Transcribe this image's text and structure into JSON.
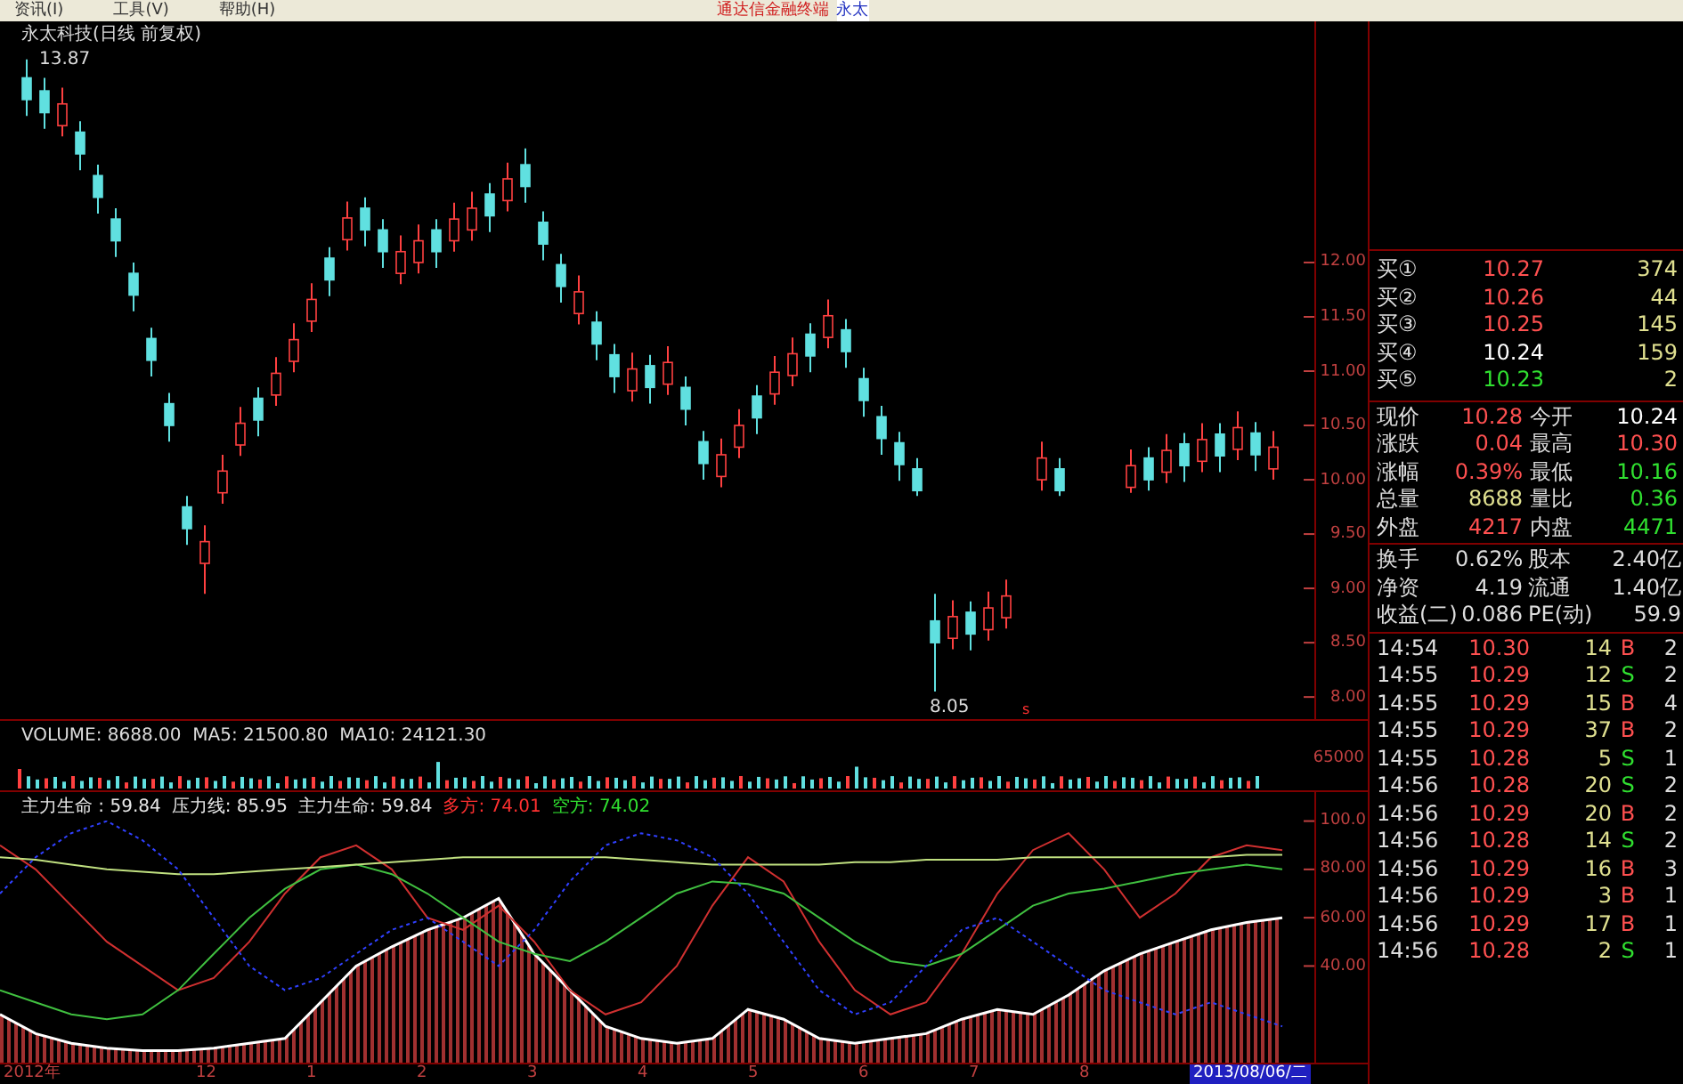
{
  "menu": {
    "items": [
      "资讯(I)",
      "工具(V)",
      "帮助(H)"
    ],
    "app_title": "通达信金融终端",
    "stock_tab": "永太"
  },
  "price_chart": {
    "title": "永太科技(日线 前复权)",
    "high_label": "13.87",
    "low_label": "8.05",
    "marker": "s",
    "chart_data": {
      "type": "candlestick",
      "ylim": [
        7.78,
        14.22
      ],
      "yticks": [
        {
          "value": 12,
          "label": "12.00"
        },
        {
          "value": 11.5,
          "label": "11.50"
        },
        {
          "value": 11,
          "label": "11.00"
        },
        {
          "value": 10.5,
          "label": "10.50"
        },
        {
          "value": 10,
          "label": "10.00"
        },
        {
          "value": 9.5,
          "label": "9.50"
        },
        {
          "value": 9,
          "label": "9.00"
        },
        {
          "value": 8.5,
          "label": "8.50"
        },
        {
          "value": 8,
          "label": "8.00"
        }
      ],
      "ohlc": [
        [
          13.7,
          13.87,
          13.35,
          13.5
        ],
        [
          13.58,
          13.7,
          13.23,
          13.38
        ],
        [
          13.26,
          13.61,
          13.16,
          13.46
        ],
        [
          13.2,
          13.3,
          12.85,
          13.0
        ],
        [
          12.8,
          12.9,
          12.45,
          12.6
        ],
        [
          12.4,
          12.5,
          12.05,
          12.2
        ],
        [
          11.9,
          12.0,
          11.55,
          11.7
        ],
        [
          11.3,
          11.4,
          10.95,
          11.1
        ],
        [
          10.7,
          10.8,
          10.35,
          10.5
        ],
        [
          9.75,
          9.85,
          9.4,
          9.55
        ],
        [
          9.23,
          9.58,
          8.95,
          9.43
        ],
        [
          9.88,
          10.23,
          9.78,
          10.08
        ],
        [
          10.32,
          10.67,
          10.22,
          10.52
        ],
        [
          10.75,
          10.85,
          10.4,
          10.55
        ],
        [
          10.78,
          11.13,
          10.68,
          10.98
        ],
        [
          11.09,
          11.44,
          10.99,
          11.29
        ],
        [
          11.46,
          11.81,
          11.36,
          11.66
        ],
        [
          12.04,
          12.14,
          11.69,
          11.84
        ],
        [
          12.21,
          12.56,
          12.11,
          12.41
        ],
        [
          12.5,
          12.6,
          12.15,
          12.3
        ],
        [
          12.3,
          12.4,
          11.95,
          12.1
        ],
        [
          11.9,
          12.25,
          11.8,
          12.1
        ],
        [
          12.0,
          12.35,
          11.9,
          12.2
        ],
        [
          12.3,
          12.4,
          11.95,
          12.1
        ],
        [
          12.2,
          12.55,
          12.1,
          12.4
        ],
        [
          12.3,
          12.65,
          12.2,
          12.5
        ],
        [
          12.63,
          12.73,
          12.28,
          12.43
        ],
        [
          12.57,
          12.92,
          12.47,
          12.77
        ],
        [
          12.9,
          13.05,
          12.55,
          12.7
        ],
        [
          12.37,
          12.47,
          12.02,
          12.17
        ],
        [
          11.98,
          12.08,
          11.63,
          11.78
        ],
        [
          11.53,
          11.88,
          11.43,
          11.73
        ],
        [
          11.45,
          11.55,
          11.1,
          11.25
        ],
        [
          11.15,
          11.25,
          10.8,
          10.95
        ],
        [
          10.82,
          11.17,
          10.72,
          11.02
        ],
        [
          11.05,
          11.15,
          10.7,
          10.85
        ],
        [
          10.88,
          11.23,
          10.78,
          11.08
        ],
        [
          10.85,
          10.95,
          10.5,
          10.65
        ],
        [
          10.35,
          10.45,
          10.0,
          10.15
        ],
        [
          10.03,
          10.38,
          9.93,
          10.23
        ],
        [
          10.3,
          10.65,
          10.2,
          10.5
        ],
        [
          10.77,
          10.87,
          10.42,
          10.57
        ],
        [
          10.79,
          11.14,
          10.69,
          10.99
        ],
        [
          10.96,
          11.31,
          10.86,
          11.16
        ],
        [
          11.34,
          11.44,
          10.99,
          11.14
        ],
        [
          11.31,
          11.66,
          11.21,
          11.51
        ],
        [
          11.38,
          11.48,
          11.03,
          11.18
        ],
        [
          10.93,
          11.03,
          10.58,
          10.73
        ],
        [
          10.58,
          10.68,
          10.23,
          10.38
        ],
        [
          10.34,
          10.44,
          9.99,
          10.14
        ],
        [
          10.1,
          10.2,
          9.85,
          9.9
        ],
        [
          8.7,
          8.95,
          8.05,
          8.5
        ],
        [
          8.54,
          8.89,
          8.44,
          8.74
        ],
        [
          8.78,
          8.88,
          8.43,
          8.58
        ],
        [
          8.62,
          8.97,
          8.52,
          8.82
        ],
        [
          8.73,
          9.08,
          8.63,
          8.93
        ],
        null,
        [
          10.0,
          10.35,
          9.9,
          10.2
        ],
        [
          10.1,
          10.2,
          9.85,
          9.9
        ],
        null,
        null,
        null,
        [
          9.93,
          10.28,
          9.88,
          10.13
        ],
        [
          10.2,
          10.3,
          9.9,
          10.0
        ],
        [
          10.07,
          10.42,
          9.97,
          10.27
        ],
        [
          10.33,
          10.43,
          9.98,
          10.13
        ],
        [
          10.17,
          10.52,
          10.07,
          10.37
        ],
        [
          10.42,
          10.52,
          10.07,
          10.22
        ],
        [
          10.28,
          10.63,
          10.18,
          10.48
        ],
        [
          10.43,
          10.53,
          10.08,
          10.23
        ],
        [
          10.1,
          10.45,
          10.0,
          10.3
        ]
      ]
    }
  },
  "volume_chart": {
    "legend": "VOLUME: 8688.00  MA5: 21500.80  MA10: 24121.30",
    "axis": [
      "65000"
    ]
  },
  "indicator_chart": {
    "legend": [
      {
        "text": "主力生命 : 59.84",
        "color": "#e8e8e8"
      },
      {
        "text": "压力线: 85.95",
        "color": "#e8e8e8"
      },
      {
        "text": "主力生命: 59.84",
        "color": "#e8e8e8"
      },
      {
        "text": "多方: 74.01",
        "color": "#ff3030"
      },
      {
        "text": "空方: 74.02",
        "color": "#30e030"
      }
    ],
    "chart_data": {
      "type": "line",
      "ylim": [
        0,
        112
      ],
      "yticks": [
        {
          "value": 100,
          "label": "100.0"
        },
        {
          "value": 80,
          "label": "80.00"
        },
        {
          "value": 60,
          "label": "60.00"
        },
        {
          "value": 40,
          "label": "40.00"
        }
      ],
      "series": [
        {
          "type": "area",
          "color": "#ffffff",
          "values": [
            20,
            12,
            8,
            6,
            5,
            5,
            6,
            8,
            10,
            25,
            40,
            48,
            55,
            60,
            68,
            45,
            30,
            15,
            10,
            8,
            10,
            22,
            18,
            10,
            8,
            10,
            12,
            18,
            22,
            20,
            28,
            38,
            45,
            50,
            55,
            58,
            60
          ]
        },
        {
          "type": "line",
          "color": "#d03030",
          "values": [
            90,
            80,
            65,
            50,
            40,
            30,
            35,
            50,
            70,
            85,
            90,
            80,
            60,
            55,
            65,
            50,
            30,
            20,
            25,
            40,
            65,
            85,
            75,
            50,
            30,
            20,
            25,
            45,
            70,
            88,
            95,
            80,
            60,
            70,
            85,
            90,
            88
          ]
        },
        {
          "type": "line",
          "color": "#40c040",
          "values": [
            30,
            25,
            20,
            18,
            20,
            30,
            45,
            60,
            72,
            80,
            82,
            78,
            70,
            60,
            50,
            45,
            42,
            50,
            60,
            70,
            75,
            74,
            70,
            60,
            50,
            42,
            40,
            45,
            55,
            65,
            70,
            72,
            75,
            78,
            80,
            82,
            80
          ]
        },
        {
          "type": "line",
          "color": "#c0e080",
          "values": [
            85,
            84,
            82,
            80,
            79,
            78,
            78,
            79,
            80,
            81,
            82,
            83,
            84,
            85,
            85,
            85,
            85,
            85,
            84,
            83,
            82,
            82,
            82,
            82,
            83,
            83,
            84,
            84,
            84,
            85,
            85,
            85,
            85,
            85,
            85,
            86,
            86
          ]
        },
        {
          "type": "line",
          "color": "#3040ff",
          "line_style": "dashed",
          "values": [
            70,
            85,
            95,
            100,
            92,
            80,
            60,
            40,
            30,
            35,
            45,
            55,
            60,
            50,
            40,
            55,
            75,
            90,
            95,
            92,
            85,
            70,
            50,
            30,
            20,
            25,
            40,
            55,
            60,
            50,
            40,
            30,
            25,
            20,
            25,
            20,
            15
          ]
        }
      ]
    }
  },
  "date_axis": {
    "labels": [
      "2012年",
      "12",
      "1",
      "2",
      "3",
      "4",
      "5",
      "6",
      "7",
      "8"
    ],
    "current": "2013/08/06/二"
  },
  "order_book": [
    {
      "label": "买①",
      "price": "10.27",
      "color": "#ff5050",
      "volume": "374"
    },
    {
      "label": "买②",
      "price": "10.26",
      "color": "#ff5050",
      "volume": "44"
    },
    {
      "label": "买③",
      "price": "10.25",
      "color": "#ff5050",
      "volume": "145"
    },
    {
      "label": "买④",
      "price": "10.24",
      "color": "#ffffff",
      "volume": "159"
    },
    {
      "label": "买⑤",
      "price": "10.23",
      "color": "#30e030",
      "volume": "2"
    }
  ],
  "quote": [
    [
      {
        "label": "现价",
        "value": "10.28",
        "color": "#ff5050"
      },
      {
        "label": "今开",
        "value": "10.24",
        "color": "#ffffff"
      }
    ],
    [
      {
        "label": "涨跌",
        "value": "0.04",
        "color": "#ff5050"
      },
      {
        "label": "最高",
        "value": "10.30",
        "color": "#ff5050"
      }
    ],
    [
      {
        "label": "涨幅",
        "value": "0.39%",
        "color": "#ff5050"
      },
      {
        "label": "最低",
        "value": "10.16",
        "color": "#30e030"
      }
    ],
    [
      {
        "label": "总量",
        "value": "8688",
        "color": "#e0e090"
      },
      {
        "label": "量比",
        "value": "0.36",
        "color": "#30e030"
      }
    ],
    [
      {
        "label": "外盘",
        "value": "4217",
        "color": "#ff5050"
      },
      {
        "label": "内盘",
        "value": "4471",
        "color": "#30e030"
      }
    ]
  ],
  "finance": [
    {
      "label": "换手",
      "value": "0.62%",
      "label2": "股本",
      "value2": "2.40亿"
    },
    {
      "label": "净资",
      "value": "4.19",
      "label2": "流通",
      "value2": "1.40亿"
    },
    {
      "label": "收益(二)",
      "value": "0.086",
      "label2": "PE(动)",
      "value2": "59.9"
    }
  ],
  "trades": [
    {
      "time": "14:54",
      "price": "10.30",
      "volume": "14",
      "side": "B",
      "count": "2"
    },
    {
      "time": "14:55",
      "price": "10.29",
      "volume": "12",
      "side": "S",
      "count": "2"
    },
    {
      "time": "14:55",
      "price": "10.29",
      "volume": "15",
      "side": "B",
      "count": "4"
    },
    {
      "time": "14:55",
      "price": "10.29",
      "volume": "37",
      "side": "B",
      "count": "2"
    },
    {
      "time": "14:55",
      "price": "10.28",
      "volume": "5",
      "side": "S",
      "count": "1"
    },
    {
      "time": "14:56",
      "price": "10.28",
      "volume": "20",
      "side": "S",
      "count": "2"
    },
    {
      "time": "14:56",
      "price": "10.29",
      "volume": "20",
      "side": "B",
      "count": "2"
    },
    {
      "time": "14:56",
      "price": "10.28",
      "volume": "14",
      "side": "S",
      "count": "2"
    },
    {
      "time": "14:56",
      "price": "10.29",
      "volume": "16",
      "side": "B",
      "count": "3"
    },
    {
      "time": "14:56",
      "price": "10.29",
      "volume": "3",
      "side": "B",
      "count": "1"
    },
    {
      "time": "14:56",
      "price": "10.29",
      "volume": "17",
      "side": "B",
      "count": "1"
    },
    {
      "time": "14:56",
      "price": "10.28",
      "volume": "2",
      "side": "S",
      "count": "1"
    }
  ]
}
